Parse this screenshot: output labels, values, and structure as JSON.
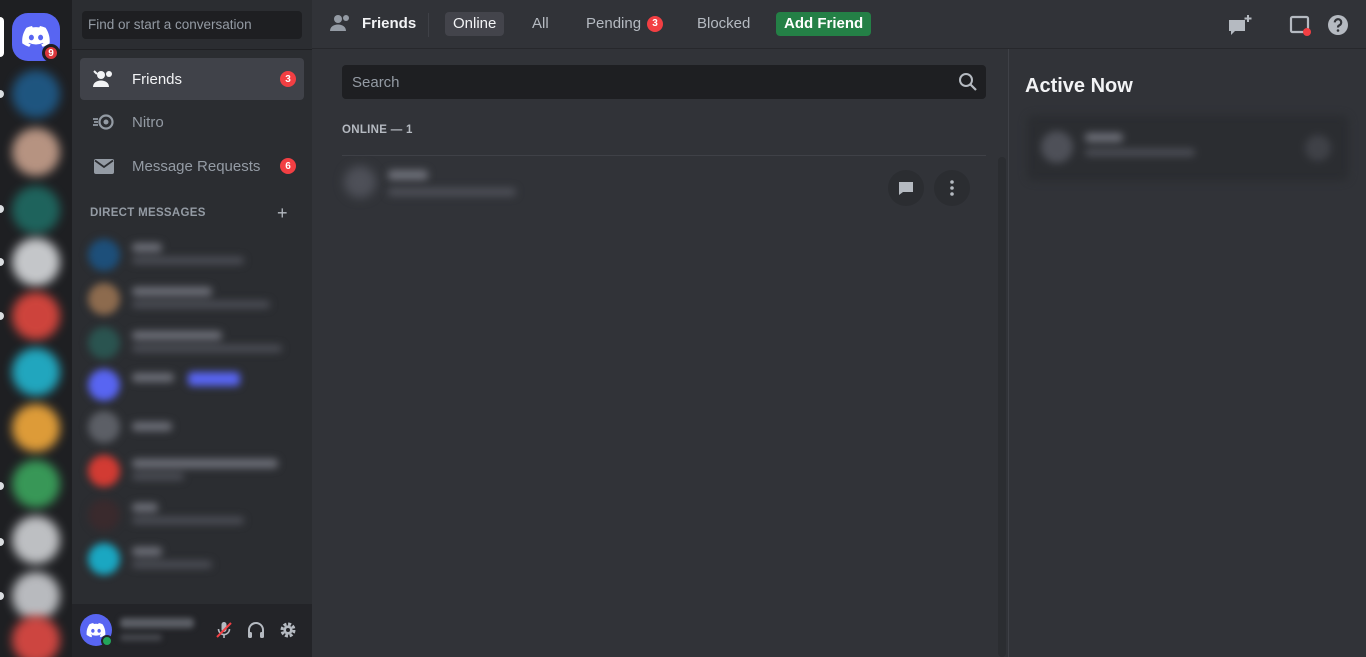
{
  "rail": {
    "home_badge": "9"
  },
  "sidebar": {
    "search_placeholder": "Find or start a conversation",
    "nav": [
      {
        "label": "Friends",
        "badge": "3"
      },
      {
        "label": "Nitro"
      },
      {
        "label": "Message Requests",
        "badge": "6"
      }
    ],
    "dm_header": "DIRECT MESSAGES"
  },
  "topbar": {
    "title": "Friends",
    "tabs": [
      {
        "label": "Online"
      },
      {
        "label": "All"
      },
      {
        "label": "Pending",
        "badge": "3"
      },
      {
        "label": "Blocked"
      },
      {
        "label": "Add Friend"
      }
    ]
  },
  "main": {
    "search_placeholder": "Search",
    "online_label": "ONLINE — 1"
  },
  "active_now": {
    "title": "Active Now"
  },
  "colors": {
    "accent": "#5865f2",
    "badge_red": "#f23f43",
    "add_friend_green": "#248046",
    "online_green": "#23a55a"
  }
}
